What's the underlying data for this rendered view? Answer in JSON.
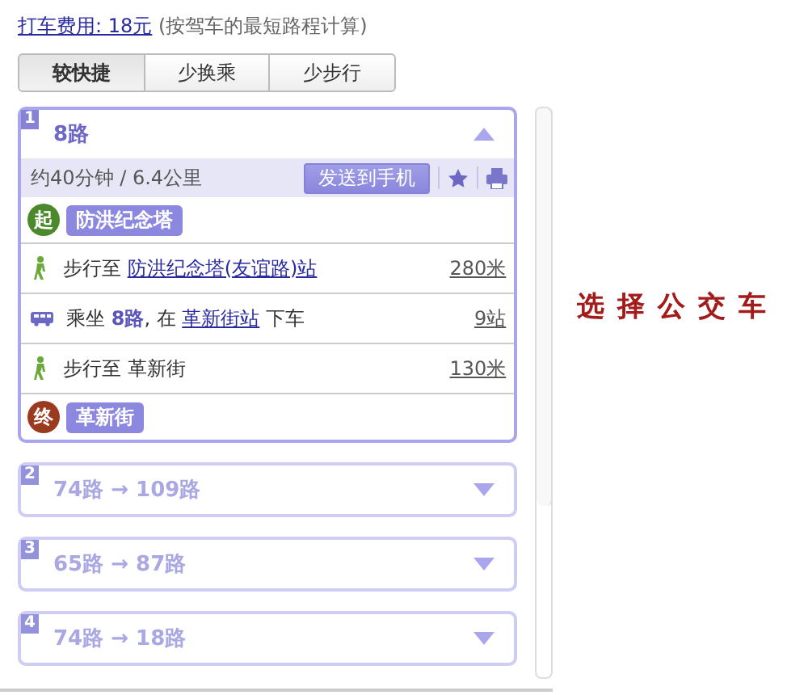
{
  "fare": {
    "link": "打车费用: 18元",
    "note": "(按驾车的最短路程计算)"
  },
  "tabs": [
    {
      "label": "较快捷",
      "selected": true
    },
    {
      "label": "少换乘",
      "selected": false
    },
    {
      "label": "少步行",
      "selected": false
    }
  ],
  "routes": [
    {
      "number": "1",
      "title": "8路",
      "expanded": true,
      "summary": "约40分钟 / 6.4公里",
      "send_button": "发送到手机",
      "start": {
        "badge": "起",
        "name": "防洪纪念塔"
      },
      "steps": [
        {
          "kind": "walk",
          "prefix": "步行至 ",
          "link": "防洪纪念塔(友谊路)站",
          "distance": "280米"
        },
        {
          "kind": "bus",
          "prefix": "乘坐 **8路**, 在 ",
          "link": "革新街站",
          "suffix": " 下车",
          "distance": "9站"
        },
        {
          "kind": "walk",
          "prefix": "步行至 革新街",
          "distance": "130米"
        }
      ],
      "end": {
        "badge": "终",
        "name": "革新街"
      }
    },
    {
      "number": "2",
      "title": "74路 → 109路",
      "expanded": false
    },
    {
      "number": "3",
      "title": "65路 → 87路",
      "expanded": false
    },
    {
      "number": "4",
      "title": "74路 → 18路",
      "expanded": false
    }
  ],
  "caption": "选择公交车"
}
